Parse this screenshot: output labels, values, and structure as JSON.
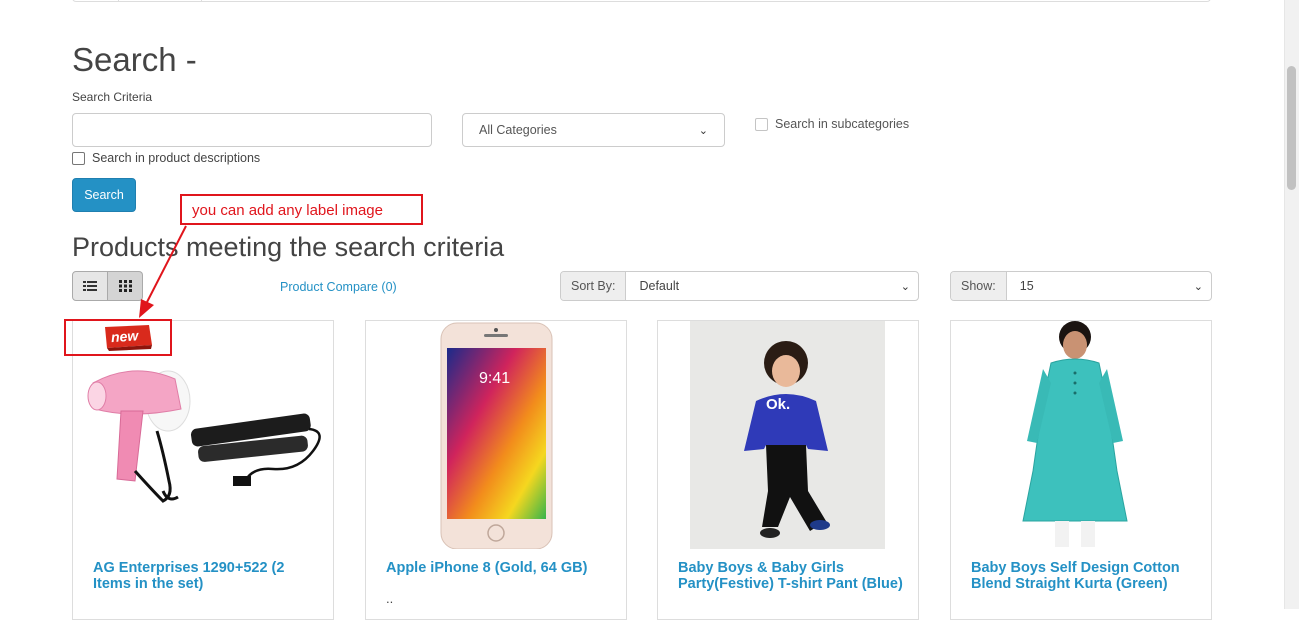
{
  "page": {
    "title": "Search -",
    "criteria_label": "Search Criteria",
    "search_input": {
      "value": "",
      "placeholder": ""
    },
    "category_select": {
      "selected": "All Categories"
    },
    "subcategories_label": "Search in subcategories",
    "descriptions_label": "Search in product descriptions",
    "search_button": "Search",
    "results_title": "Products meeting the search criteria"
  },
  "annotation": {
    "text": "you can add any label image",
    "color": "#e0151c"
  },
  "toolbar": {
    "compare_link": "Product Compare (0)",
    "sort_label": "Sort By:",
    "sort_value": "Default",
    "show_label": "Show:",
    "show_value": "15"
  },
  "products": [
    {
      "name": "AG Enterprises 1290+522 (2 Items in the set)",
      "desc": "",
      "badge": "new"
    },
    {
      "name": "Apple iPhone 8 (Gold, 64 GB)",
      "desc": "..",
      "time": "9:41"
    },
    {
      "name": "Baby Boys & Baby Girls Party(Festive) T-shirt Pant (Blue)",
      "desc": "",
      "shirt_text": "Ok."
    },
    {
      "name": "Baby Boys Self Design Cotton Blend Straight Kurta (Green)",
      "desc": ""
    }
  ],
  "colors": {
    "accent": "#2491c5",
    "annotation": "#e0151c"
  }
}
